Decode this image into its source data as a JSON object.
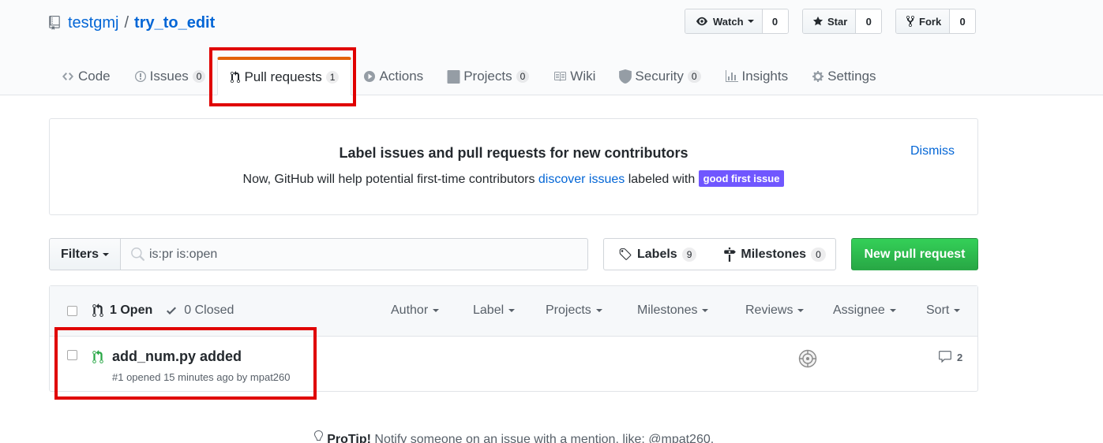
{
  "repo": {
    "owner": "testgmj",
    "separator": "/",
    "name": "try_to_edit"
  },
  "actions": {
    "watch": {
      "label": "Watch",
      "count": "0"
    },
    "star": {
      "label": "Star",
      "count": "0"
    },
    "fork": {
      "label": "Fork",
      "count": "0"
    }
  },
  "tabs": [
    {
      "label": "Code",
      "icon": "code-icon"
    },
    {
      "label": "Issues",
      "count": "0",
      "icon": "issue-icon"
    },
    {
      "label": "Pull requests",
      "count": "1",
      "icon": "pull-request-icon",
      "selected": true
    },
    {
      "label": "Actions",
      "icon": "play-icon"
    },
    {
      "label": "Projects",
      "count": "0",
      "icon": "project-icon"
    },
    {
      "label": "Wiki",
      "icon": "book-icon"
    },
    {
      "label": "Security",
      "count": "0",
      "icon": "shield-icon"
    },
    {
      "label": "Insights",
      "icon": "graph-icon"
    },
    {
      "label": "Settings",
      "icon": "gear-icon"
    }
  ],
  "banner": {
    "title": "Label issues and pull requests for new contributors",
    "text_before": "Now, GitHub will help potential first-time contributors ",
    "link": "discover issues",
    "text_after": " labeled with ",
    "label": "good first issue",
    "dismiss": "Dismiss"
  },
  "subnav": {
    "filters": "Filters",
    "search_value": "is:pr is:open",
    "labels": "Labels",
    "labels_count": "9",
    "milestones": "Milestones",
    "milestones_count": "0",
    "new_pr": "New pull request"
  },
  "list": {
    "open": "1 Open",
    "closed": "0 Closed",
    "filters": [
      "Author",
      "Label",
      "Projects",
      "Milestones",
      "Reviews",
      "Assignee",
      "Sort"
    ]
  },
  "pulls": [
    {
      "title": "add_num.py added",
      "meta": "#1 opened 15 minutes ago by mpat260",
      "comments": "2"
    }
  ],
  "protip": {
    "bold": "ProTip!",
    "text": " Notify someone on an issue with a mention, like: @mpat260."
  },
  "colors": {
    "accent": "#0366d6",
    "selected_tab": "#e36209",
    "new_pr": "#28a745",
    "good_first_issue": "#7057ff",
    "highlight": "#e00000"
  }
}
